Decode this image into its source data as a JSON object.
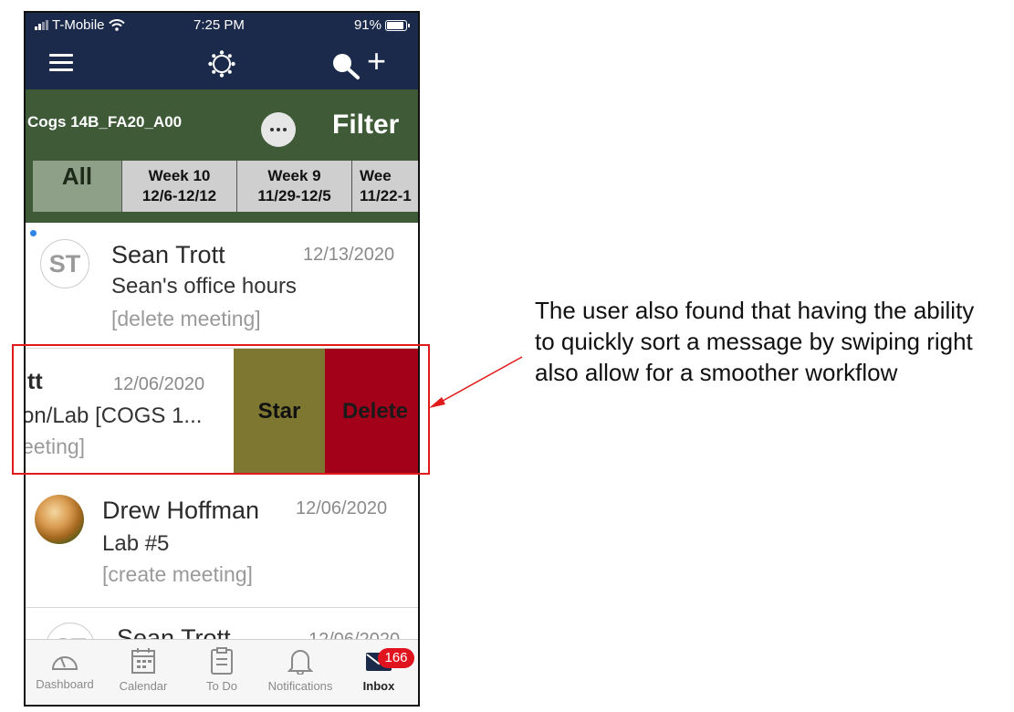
{
  "status_bar": {
    "carrier": "T-Mobile",
    "time": "7:25 PM",
    "battery": "91%"
  },
  "nav_bar": {
    "menu_icon": "hamburger-icon",
    "logo_icon": "canvas-logo-icon",
    "search_icon": "search-icon",
    "add_icon": "plus-icon"
  },
  "course": {
    "name": "Cogs 14B_FA20_A00",
    "filter_label": "Filter"
  },
  "week_tabs": [
    {
      "label": "All",
      "range": ""
    },
    {
      "label": "Week 10",
      "range": "12/6-12/12"
    },
    {
      "label": "Week 9",
      "range": "11/29-12/5"
    },
    {
      "label": "Wee",
      "range": "11/22-1"
    }
  ],
  "messages": [
    {
      "initials": "ST",
      "sender": "Sean Trott",
      "date": "12/13/2020",
      "subject": "Sean's office hours",
      "preview": "[delete meeting]",
      "unread": true
    },
    {
      "sender": "tt",
      "date": "12/06/2020",
      "subject": "on/Lab [COGS 1...",
      "preview": "eeting]"
    },
    {
      "sender": "Drew Hoffman",
      "date": "12/06/2020",
      "subject": "Lab #5",
      "preview": "[create meeting]"
    },
    {
      "initials": "ST",
      "sender": "Sean Trott",
      "date": "12/06/2020"
    }
  ],
  "swipe_actions": {
    "star": "Star",
    "delete": "Delete"
  },
  "tab_bar": [
    {
      "label": "Dashboard",
      "icon": "dashboard-icon"
    },
    {
      "label": "Calendar",
      "icon": "calendar-icon"
    },
    {
      "label": "To Do",
      "icon": "todo-icon"
    },
    {
      "label": "Notifications",
      "icon": "bell-icon"
    },
    {
      "label": "Inbox",
      "icon": "inbox-icon"
    }
  ],
  "inbox_badge": "166",
  "annotation": "The user also found that having the ability to quickly sort a message by swiping right also allow for a smoother workflow",
  "colors": {
    "nav": "#1b2a4a",
    "course_bar": "#3e5a37",
    "star": "#7d7732",
    "delete": "#a3001a",
    "highlight": "#e01a1a"
  }
}
